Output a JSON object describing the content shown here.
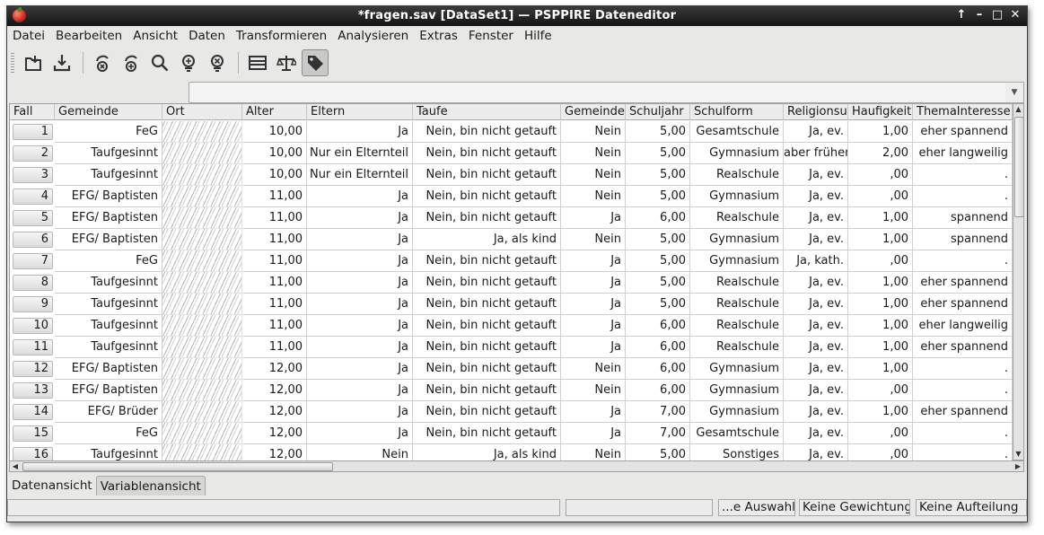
{
  "window": {
    "title": "*fragen.sav [DataSet1] — PSPPIRE Dateneditor"
  },
  "menubar": [
    "Datei",
    "Bearbeiten",
    "Ansicht",
    "Daten",
    "Transformieren",
    "Analysieren",
    "Extras",
    "Fenster",
    "Hilfe"
  ],
  "toolbar": {
    "icons": [
      "open-file-icon",
      "save-file-icon",
      "goto-case-icon",
      "goto-variable-icon",
      "find-icon",
      "insert-case-icon",
      "insert-variable-icon",
      "split-file-icon",
      "weight-cases-icon",
      "value-labels-icon"
    ]
  },
  "columns": [
    "Fall",
    "Gemeinde",
    "Ort",
    "Alter",
    "Eltern",
    "Taufe",
    "Gemeinde",
    "Schuljahr",
    "Schulform",
    "Religionsu",
    "Haufigkeit",
    "ThemaInteresse"
  ],
  "rows": [
    {
      "fall": "1",
      "gemeinde": "FeG",
      "alter": "10,00",
      "eltern": "Ja",
      "taufe": "Nein, bin nicht getauft",
      "gemeinde2": "Nein",
      "schuljahr": "5,00",
      "schulform": "Gesamtschule",
      "religion": "Ja, ev.",
      "haeufigkeit": "1,00",
      "thema": "eher spannend"
    },
    {
      "fall": "2",
      "gemeinde": "Taufgesinnt",
      "alter": "10,00",
      "eltern": "Nur ein Elternteil",
      "taufe": "Nein, bin nicht getauft",
      "gemeinde2": "Nein",
      "schuljahr": "5,00",
      "schulform": "Gymnasium",
      "religion": "aber früher",
      "haeufigkeit": "2,00",
      "thema": "eher langweilig"
    },
    {
      "fall": "3",
      "gemeinde": "Taufgesinnt",
      "alter": "10,00",
      "eltern": "Nur ein Elternteil",
      "taufe": "Nein, bin nicht getauft",
      "gemeinde2": "Nein",
      "schuljahr": "5,00",
      "schulform": "Realschule",
      "religion": "Ja, ev.",
      "haeufigkeit": ",00",
      "thema": "."
    },
    {
      "fall": "4",
      "gemeinde": "EFG/ Baptisten",
      "alter": "11,00",
      "eltern": "Ja",
      "taufe": "Nein, bin nicht getauft",
      "gemeinde2": "Nein",
      "schuljahr": "5,00",
      "schulform": "Gymnasium",
      "religion": "Ja, ev.",
      "haeufigkeit": ",00",
      "thema": "."
    },
    {
      "fall": "5",
      "gemeinde": "EFG/ Baptisten",
      "alter": "11,00",
      "eltern": "Ja",
      "taufe": "Nein, bin nicht getauft",
      "gemeinde2": "Ja",
      "schuljahr": "6,00",
      "schulform": "Realschule",
      "religion": "Ja, ev.",
      "haeufigkeit": "1,00",
      "thema": "spannend"
    },
    {
      "fall": "6",
      "gemeinde": "EFG/ Baptisten",
      "alter": "11,00",
      "eltern": "Ja",
      "taufe": "Ja, als kind",
      "gemeinde2": "Nein",
      "schuljahr": "5,00",
      "schulform": "Gymnasium",
      "religion": "Ja, ev.",
      "haeufigkeit": "1,00",
      "thema": "spannend"
    },
    {
      "fall": "7",
      "gemeinde": "FeG",
      "alter": "11,00",
      "eltern": "Ja",
      "taufe": "Nein, bin nicht getauft",
      "gemeinde2": "Ja",
      "schuljahr": "5,00",
      "schulform": "Gymnasium",
      "religion": "Ja, kath.",
      "haeufigkeit": ",00",
      "thema": "."
    },
    {
      "fall": "8",
      "gemeinde": "Taufgesinnt",
      "alter": "11,00",
      "eltern": "Ja",
      "taufe": "Nein, bin nicht getauft",
      "gemeinde2": "Ja",
      "schuljahr": "5,00",
      "schulform": "Realschule",
      "religion": "Ja, ev.",
      "haeufigkeit": "1,00",
      "thema": "eher spannend"
    },
    {
      "fall": "9",
      "gemeinde": "Taufgesinnt",
      "alter": "11,00",
      "eltern": "Ja",
      "taufe": "Nein, bin nicht getauft",
      "gemeinde2": "Ja",
      "schuljahr": "5,00",
      "schulform": "Realschule",
      "religion": "Ja, ev.",
      "haeufigkeit": "1,00",
      "thema": "eher spannend"
    },
    {
      "fall": "10",
      "gemeinde": "Taufgesinnt",
      "alter": "11,00",
      "eltern": "Ja",
      "taufe": "Nein, bin nicht getauft",
      "gemeinde2": "Ja",
      "schuljahr": "6,00",
      "schulform": "Realschule",
      "religion": "Ja, ev.",
      "haeufigkeit": "1,00",
      "thema": "eher langweilig"
    },
    {
      "fall": "11",
      "gemeinde": "Taufgesinnt",
      "alter": "11,00",
      "eltern": "Ja",
      "taufe": "Nein, bin nicht getauft",
      "gemeinde2": "Ja",
      "schuljahr": "6,00",
      "schulform": "Realschule",
      "religion": "Ja, ev.",
      "haeufigkeit": "1,00",
      "thema": "eher spannend"
    },
    {
      "fall": "12",
      "gemeinde": "EFG/ Baptisten",
      "alter": "12,00",
      "eltern": "Ja",
      "taufe": "Nein, bin nicht getauft",
      "gemeinde2": "Nein",
      "schuljahr": "6,00",
      "schulform": "Gymnasium",
      "religion": "Ja, ev.",
      "haeufigkeit": "1,00",
      "thema": "."
    },
    {
      "fall": "13",
      "gemeinde": "EFG/ Baptisten",
      "alter": "12,00",
      "eltern": "Ja",
      "taufe": "Nein, bin nicht getauft",
      "gemeinde2": "Nein",
      "schuljahr": "6,00",
      "schulform": "Gymnasium",
      "religion": "Ja, ev.",
      "haeufigkeit": ",00",
      "thema": "."
    },
    {
      "fall": "14",
      "gemeinde": "EFG/ Brüder",
      "alter": "12,00",
      "eltern": "Ja",
      "taufe": "Nein, bin nicht getauft",
      "gemeinde2": "Ja",
      "schuljahr": "7,00",
      "schulform": "Gymnasium",
      "religion": "Ja, ev.",
      "haeufigkeit": "1,00",
      "thema": "eher spannend"
    },
    {
      "fall": "15",
      "gemeinde": "FeG",
      "alter": "12,00",
      "eltern": "Ja",
      "taufe": "Nein, bin nicht getauft",
      "gemeinde2": "Ja",
      "schuljahr": "7,00",
      "schulform": "Gesamtschule",
      "religion": "Ja, ev.",
      "haeufigkeit": ",00",
      "thema": "."
    },
    {
      "fall": "16",
      "gemeinde": "Taufgesinnt",
      "alter": "12,00",
      "eltern": "Nein",
      "taufe": "Ja, als kind",
      "gemeinde2": "Nein",
      "schuljahr": "5,00",
      "schulform": "Sonstiges",
      "religion": "Ja, ev.",
      "haeufigkeit": ",00",
      "thema": "."
    }
  ],
  "tabs": [
    "Datenansicht",
    "Variablenansicht"
  ],
  "status": {
    "filter": "...e Auswahl",
    "weight": "Keine Gewichtung",
    "split": "Keine Aufteilung"
  }
}
